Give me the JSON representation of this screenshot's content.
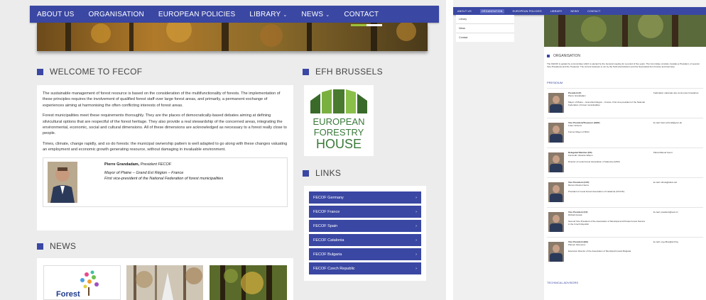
{
  "nav": {
    "items": [
      "ABOUT US",
      "ORGANISATION",
      "EUROPEAN POLICIES",
      "LIBRARY",
      "NEWS",
      "CONTACT"
    ]
  },
  "welcome": {
    "title": "WELCOME TO FECOF",
    "paragraphs": [
      "The sustainable management of forest resource is based on the consideration of the multifunctionality of forests. The implementation of these principles requires the involvement of qualified forest staff over large forest areas, and primarily, a permanent exchange of experiences aiming at harmonising the often conflicting interests of forest areas.",
      "Forest municipalities meet these requirements thoroughly. They are the places of democratically-based debates aiming at defining silvicultural options that are respectful of the forest heritage. They also provide a real stewardship of the concerned areas, integrating the environmental, economic, social and cultural dimensions. All of these dimensions are acknowledged as necessary to a forest really close to people.",
      "Times, climate, change rapidly, and so do forests: the municipal ownership pattern is well adapted to go along with these changes valuating an employment and economic growth generating resource, without damaging in invaluable environment."
    ],
    "quote": {
      "name": "Pierre Grandadam,",
      "role": "President FECOF",
      "line2": "Mayor of Plaine – Grand Est Région – France",
      "line3": "First vice-president of the National Federation of forest municipalities"
    }
  },
  "efh": {
    "title": "EFH BRUSSELS",
    "logo_lines": [
      "EUROPEAN",
      "FORESTRY",
      "HOUSE"
    ]
  },
  "links": {
    "title": "LINKS",
    "items": [
      "FECOF Germany",
      "FECOF France",
      "FECOF Spain",
      "FECOF Catalonia",
      "FECOF Bulgaria",
      "FECOF Czech Republic"
    ]
  },
  "news": {
    "title": "NEWS",
    "card1_text": "Forest"
  },
  "right": {
    "nav": [
      "ABOUT US",
      "ORGANISATION",
      "EUROPEAN POLICIES",
      "LIBRARY",
      "NEWS",
      "CONTACT"
    ],
    "submenu": [
      "Library",
      "News",
      "Contact"
    ],
    "org_title": "ORGANISATION",
    "org_intro": "The FECOF is guided by a Committee which is elected by the General meeting for a period of five years. The Committee consists, besides a President, of several Vice-Presidents and the Treasurer. The current business is run by the Technical Advisors and the Secretariat from France and Germany.",
    "presidium": "PRESIDIUM",
    "technical": "TECHNICAL ADVISORS",
    "members": [
      {
        "role": "President (F)",
        "name": "Pierre Grandadam",
        "desc": "Mayor of Plaine – Grand Est Région – France. First vice-president of the National Federation of forest municipalities",
        "addr": "Fédération nationale des communes forestières"
      },
      {
        "role": "Vice President/Treasurer (GER)",
        "name": "Franz Schmid",
        "desc": "Former Mayor of Britzi",
        "addr": "E-mail: franz.schmid@gmx.de"
      },
      {
        "role": "Delegated Member (ES)",
        "name": "Ferrandiz, Ricardo Wilson",
        "desc": "Director of Local Forest Association of Valencia (AAVF)",
        "addr": "Plaza Manuel Fenol"
      },
      {
        "role": "Vice President (CAT)",
        "name": "Ramon Rosinot Serra",
        "desc": "President of Local Forest Association of Catalonia (CFCOF)",
        "addr": "E-mail: ofinca@elteix.cat"
      },
      {
        "role": "Vice President (CZ)",
        "name": "Richard Hosek",
        "desc": "Second Vice-President of the Association of Municipal and Private Forest Owners in the Czech Republic",
        "addr": "E-mail: president@svol.cz"
      },
      {
        "role": "Vice President (BG)",
        "name": "Plamen Simeonov",
        "desc": "Executive Director of the Association of Municipal Forests Bulgaria",
        "addr": "E-mail: org.office@amf.bg"
      }
    ]
  },
  "colors": {
    "accent": "#3a47a3"
  }
}
